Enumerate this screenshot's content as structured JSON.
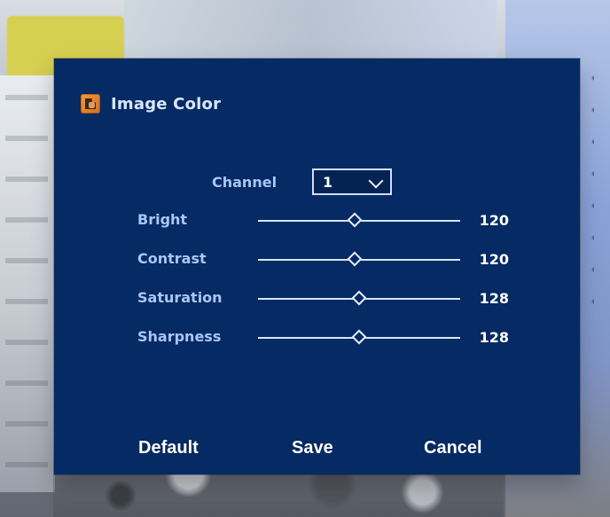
{
  "dialog": {
    "title": "Image Color",
    "icon": "image-color-icon",
    "colors": {
      "panel": "#062a63",
      "label": "#a9c7ff",
      "value": "#ffffff",
      "track": "#e7efff"
    }
  },
  "channel": {
    "label": "Channel",
    "selected": "1"
  },
  "sliders": [
    {
      "key": "bright",
      "label": "Bright",
      "value": "120",
      "fraction": 0.48
    },
    {
      "key": "contrast",
      "label": "Contrast",
      "value": "120",
      "fraction": 0.48
    },
    {
      "key": "saturation",
      "label": "Saturation",
      "value": "128",
      "fraction": 0.5
    },
    {
      "key": "sharpness",
      "label": "Sharpness",
      "value": "128",
      "fraction": 0.5
    }
  ],
  "buttons": {
    "default": "Default",
    "save": "Save",
    "cancel": "Cancel"
  }
}
